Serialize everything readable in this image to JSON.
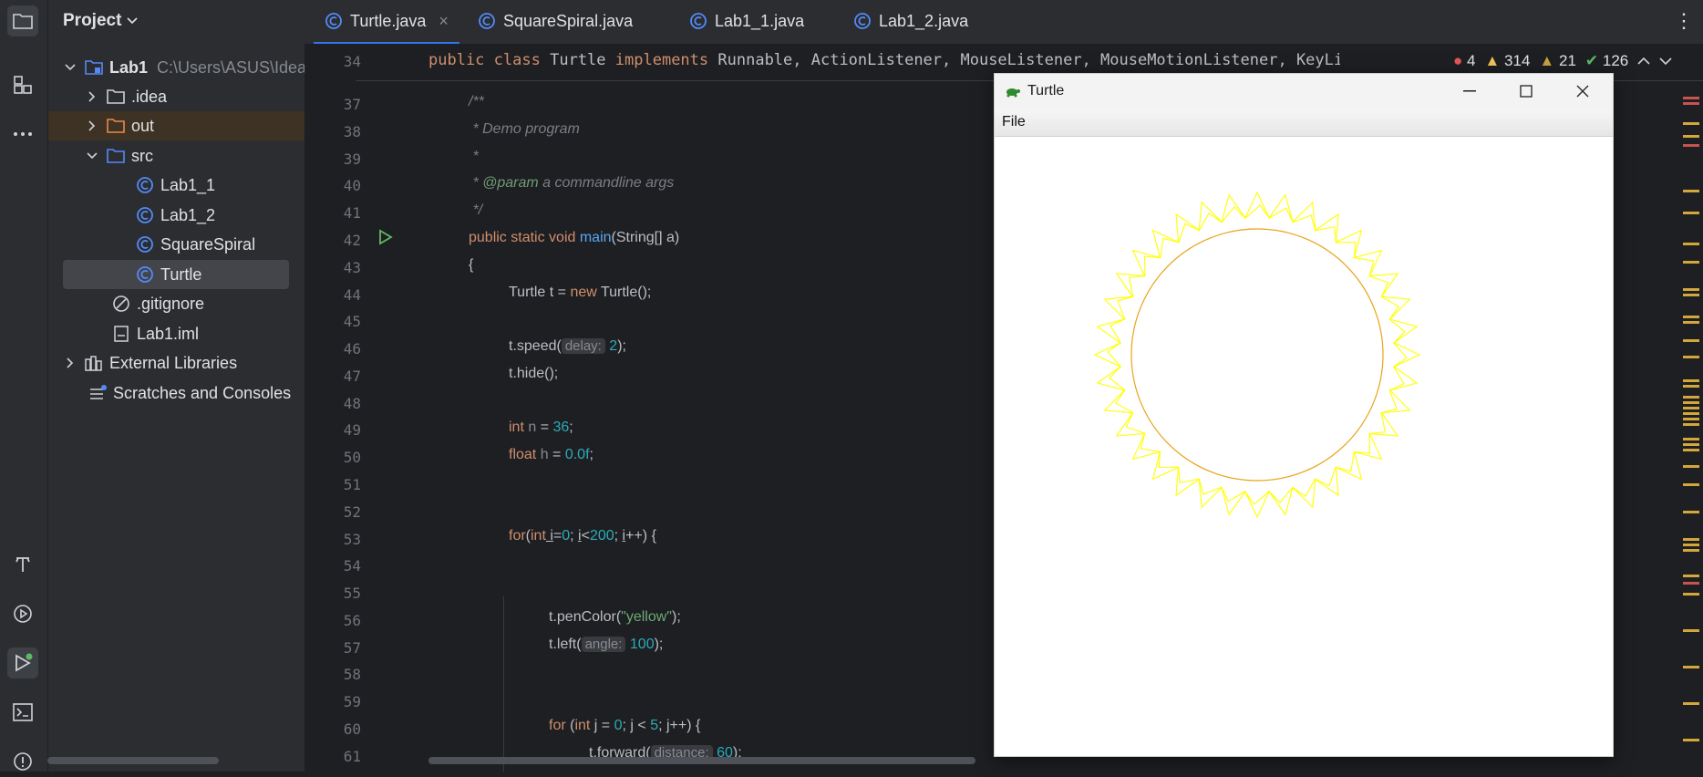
{
  "toolstrip": {
    "icons": [
      "folder-icon",
      "structure-icon",
      "more-icon",
      "build-icon",
      "services-icon",
      "run-icon",
      "terminal-icon",
      "problems-icon"
    ]
  },
  "project": {
    "title": "Project",
    "items": [
      {
        "label": "Lab1",
        "hint": "C:\\Users\\ASUS\\Idea",
        "type": "module"
      },
      {
        "label": ".idea",
        "type": "folder"
      },
      {
        "label": "out",
        "type": "folder-excluded"
      },
      {
        "label": "src",
        "type": "folder-src"
      },
      {
        "label": "Lab1_1",
        "type": "class"
      },
      {
        "label": "Lab1_2",
        "type": "class"
      },
      {
        "label": "SquareSpiral",
        "type": "class"
      },
      {
        "label": "Turtle",
        "type": "class",
        "selected": true
      },
      {
        "label": ".gitignore",
        "type": "ignore"
      },
      {
        "label": "Lab1.iml",
        "type": "file"
      },
      {
        "label": "External Libraries",
        "type": "libs"
      },
      {
        "label": "Scratches and Consoles",
        "type": "scratches"
      }
    ]
  },
  "tabs": [
    {
      "label": "Turtle.java",
      "active": true,
      "close": "×"
    },
    {
      "label": "SquareSpiral.java"
    },
    {
      "label": "Lab1_1.java"
    },
    {
      "label": "Lab1_2.java"
    }
  ],
  "tab_more": "⋮",
  "inspections": {
    "errors": "4",
    "warnings": "314",
    "weak": "21",
    "ok": "126"
  },
  "sticky_line": {
    "num": "34",
    "text_kw1": "public",
    "text_kw2": "class",
    "text_name": "Turtle",
    "text_kw3": "implements",
    "text_rest": "Runnable, ActionListener, MouseListener, MouseMotionListener, KeyListe"
  },
  "code_lines": [
    {
      "num": "37"
    },
    {
      "num": "38"
    },
    {
      "num": "39"
    },
    {
      "num": "40"
    },
    {
      "num": "41"
    },
    {
      "num": "42"
    },
    {
      "num": "43"
    },
    {
      "num": "44"
    },
    {
      "num": "45"
    },
    {
      "num": "46"
    },
    {
      "num": "47"
    },
    {
      "num": "48"
    },
    {
      "num": "49"
    },
    {
      "num": "50"
    },
    {
      "num": "51"
    },
    {
      "num": "52"
    },
    {
      "num": "53"
    },
    {
      "num": "54"
    },
    {
      "num": "55"
    },
    {
      "num": "56"
    },
    {
      "num": "57"
    },
    {
      "num": "58"
    },
    {
      "num": "59"
    },
    {
      "num": "60"
    },
    {
      "num": "61"
    }
  ],
  "code": {
    "l37": "/**",
    "l38": " * Demo program",
    "l39": " *",
    "l40_a": " * ",
    "l40_tag": "@param",
    "l40_b": " a commandline args",
    "l41": " */",
    "l42_kw": "public static void ",
    "l42_fn": "main",
    "l42_rest": "(String[] a)",
    "l43": "{",
    "l44_a": "Turtle t = ",
    "l44_kw": "new",
    "l44_b": " Turtle();",
    "l46_a": "t.speed(",
    "l46_hint": "delay:",
    "l46_num": "2",
    "l46_b": ");",
    "l47": "t.hide();",
    "l49_kw": "int",
    "l49_var": " n",
    "l49_eq": " = ",
    "l49_num": "36",
    "l49_end": ";",
    "l50_kw": "float",
    "l50_var": " h",
    "l50_eq": " = ",
    "l50_num": "0.0f",
    "l50_end": ";",
    "l53_kw1": "for",
    "l53_p": "(",
    "l53_kw2": "int",
    "l53_i1": " i",
    "l53_eq": "=",
    "l53_n0": "0",
    "l53_s1": "; ",
    "l53_i2": "i",
    "l53_lt": "<",
    "l53_n200": "200",
    "l53_s2": "; ",
    "l53_i3": "i",
    "l53_end": "++) {",
    "l56_a": "t.penColor(",
    "l56_str": "\"yellow\"",
    "l56_b": ");",
    "l57_a": "t.left(",
    "l57_hint": "angle:",
    "l57_num": "100",
    "l57_b": ");",
    "l60_kw1": "for",
    "l60_p": " (",
    "l60_kw2": "int",
    "l60_a": " j = ",
    "l60_n0": "0",
    "l60_b": "; j < ",
    "l60_n5": "5",
    "l60_c": "; j++) {",
    "l61_a": "t.forward(",
    "l61_hint": "distance:",
    "l61_num": "60",
    "l61_b": ");"
  },
  "turtle_window": {
    "title": "Turtle",
    "menu_file": "File",
    "pen_color": "#ffff00",
    "circle_color": "#e8a317",
    "rays": 36
  },
  "colors": {
    "accent": "#3574f0",
    "bg": "#1e1f22",
    "panel": "#2b2d30"
  }
}
